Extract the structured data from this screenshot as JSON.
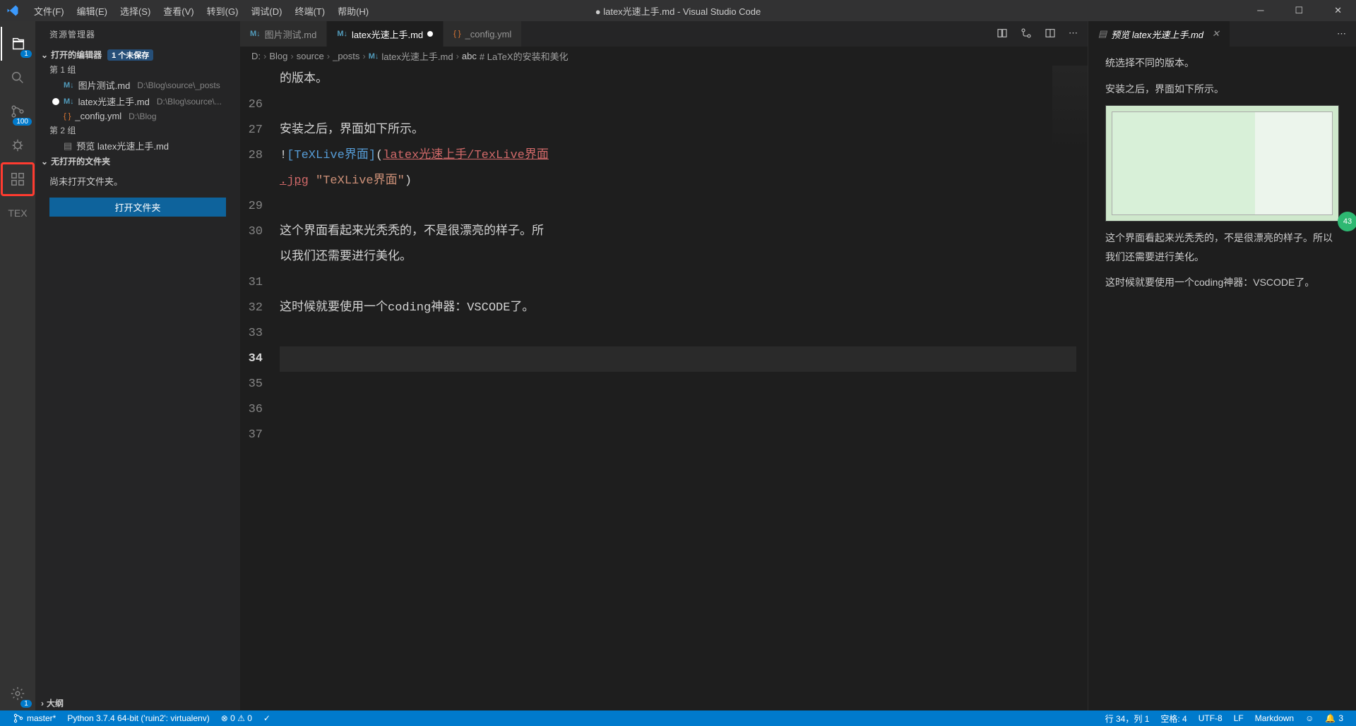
{
  "title": "● latex光速上手.md - Visual Studio Code",
  "menu": [
    "文件(F)",
    "编辑(E)",
    "选择(S)",
    "查看(V)",
    "转到(G)",
    "调试(D)",
    "终端(T)",
    "帮助(H)"
  ],
  "activity": {
    "explorer_badge": "1",
    "scm_badge": "100",
    "gear_badge": "1",
    "tex_label": "TEX"
  },
  "sidebar": {
    "header": "资源管理器",
    "open_editors_label": "打开的编辑器",
    "unsaved_badge": "1 个未保存",
    "group1": "第 1 组",
    "group2": "第 2 组",
    "files": {
      "f1": {
        "name": "图片测试.md",
        "path": "D:\\Blog\\source\\_posts"
      },
      "f2": {
        "name": "latex光速上手.md",
        "path": "D:\\Blog\\source\\..."
      },
      "f3": {
        "name": "_config.yml",
        "path": "D:\\Blog"
      },
      "f4": {
        "name": "预览 latex光速上手.md"
      }
    },
    "no_folder_label": "无打开的文件夹",
    "no_folder_msg": "尚未打开文件夹。",
    "open_folder_btn": "打开文件夹",
    "outline": "大纲"
  },
  "tabs": {
    "t1": "图片测试.md",
    "t2": "latex光速上手.md",
    "t3": "_config.yml"
  },
  "breadcrumb": {
    "p1": "D:",
    "p2": "Blog",
    "p3": "source",
    "p4": "_posts",
    "p5": "latex光速上手.md",
    "p6": "# LaTeX的安装和美化"
  },
  "code": {
    "l25": "的版本。",
    "l26": "",
    "l27": "安装之后，界面如下所示。",
    "l28a": "![TeXLive界面]",
    "l28b_link": "latex光速上手/TexLive界面",
    "l28c_link": ".jpg",
    "l28d_str": " \"TeXLive界面\"",
    "l29": "",
    "l30": "这个界面看起来光秃秃的，不是很漂亮的样子。所",
    "l30b": "以我们还需要进行美化。",
    "l31": "",
    "l32": "这时候就要使用一个coding神器：VSCODE了。",
    "l33": "",
    "l34": "",
    "l35": "",
    "l36": "",
    "l37": ""
  },
  "line_numbers": [
    "",
    "26",
    "27",
    "28",
    "",
    "29",
    "30",
    "",
    "31",
    "32",
    "33",
    "34",
    "35",
    "36",
    "37"
  ],
  "preview_tab": "预览 latex光速上手.md",
  "preview": {
    "p0": "统选择不同的版本。",
    "p1": "安装之后，界面如下所示。",
    "p2": "这个界面看起来光秃秃的，不是很漂亮的样子。所以我们还需要进行美化。",
    "p3": "这时候就要使用一个coding神器：VSCODE了。"
  },
  "green_badge": "43",
  "status": {
    "branch": "master*",
    "python": "Python 3.7.4 64-bit ('ruin2': virtualenv)",
    "errors": "⊗ 0 ⚠ 0",
    "ln_col": "行 34，列 1",
    "spaces": "空格: 4",
    "encoding": "UTF-8",
    "eol": "LF",
    "lang": "Markdown",
    "bell": "3"
  }
}
